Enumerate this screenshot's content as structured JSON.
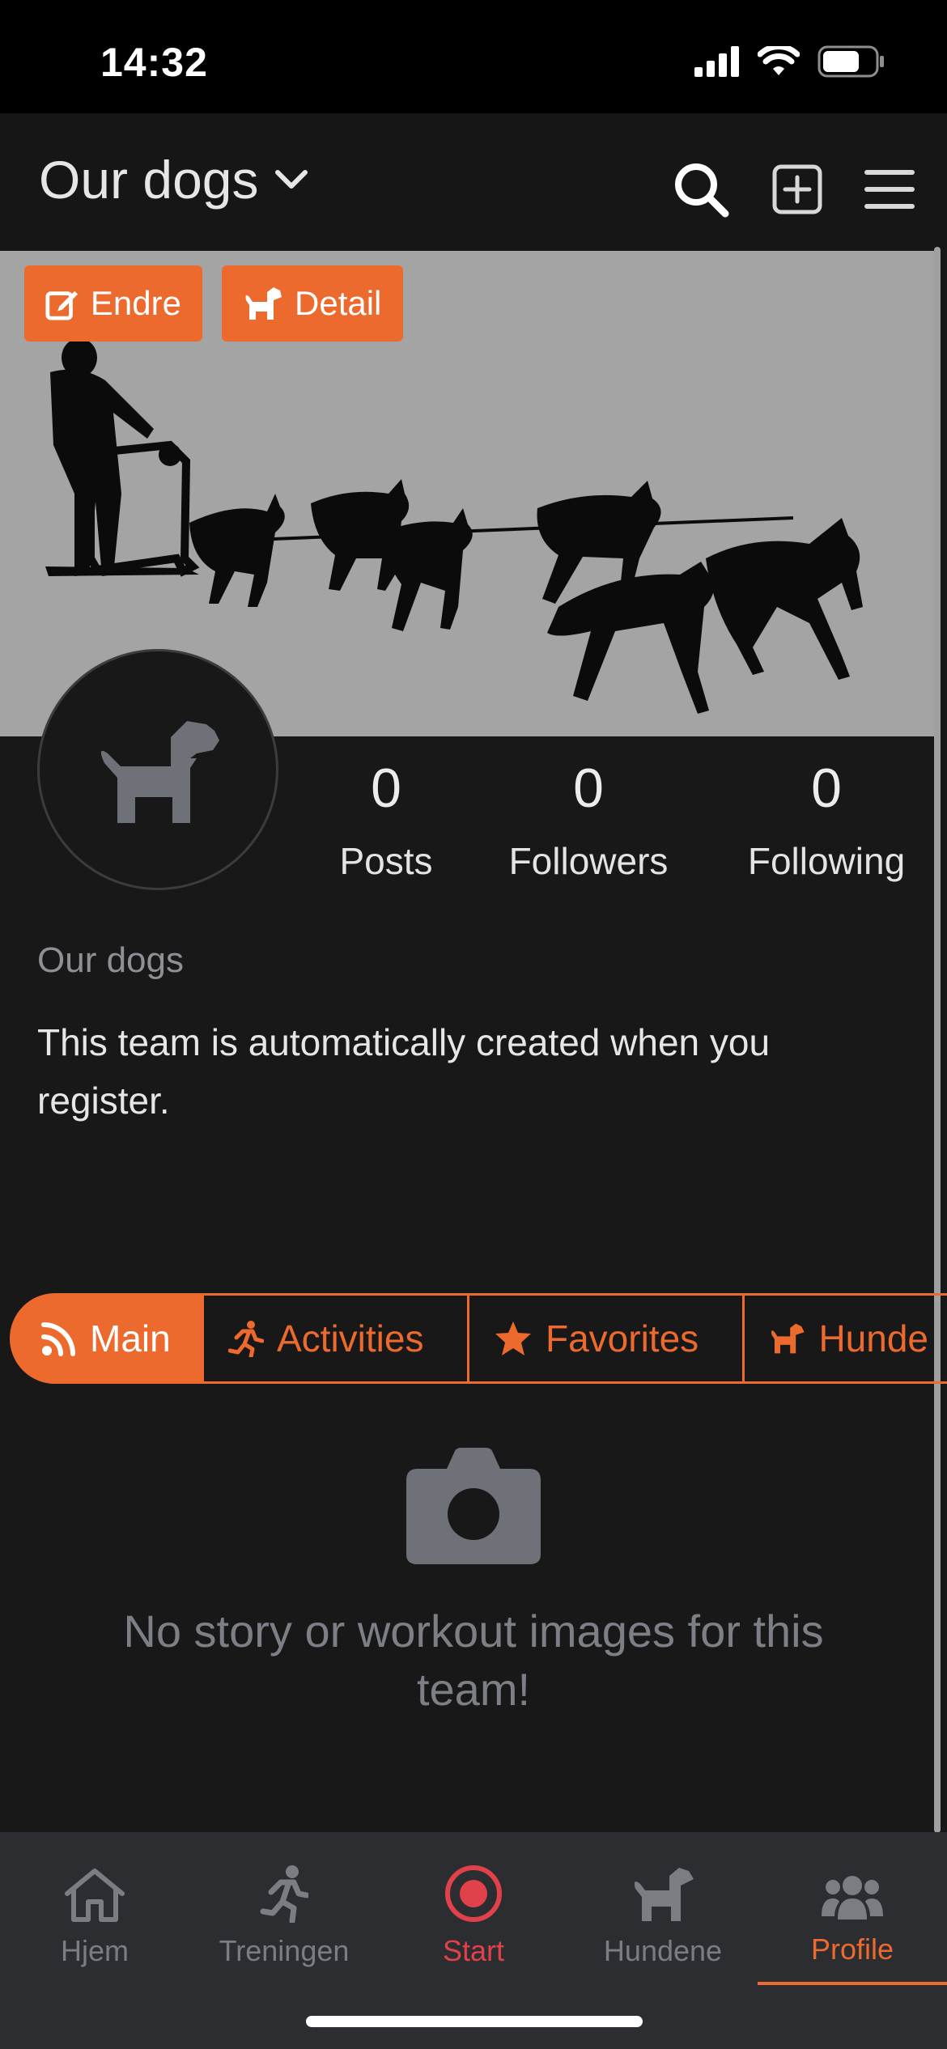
{
  "status_bar": {
    "time": "14:32"
  },
  "header": {
    "title": "Our dogs"
  },
  "cover": {
    "edit_label": "Endre",
    "detail_label": "Detail"
  },
  "stats": [
    {
      "value": "0",
      "label": "Posts"
    },
    {
      "value": "0",
      "label": "Followers"
    },
    {
      "value": "0",
      "label": "Following"
    }
  ],
  "profile": {
    "name": "Our dogs",
    "description": "This team is automatically created when you register."
  },
  "tabs": [
    {
      "label": "Main",
      "icon": "rss-icon",
      "active": true
    },
    {
      "label": "Activities",
      "icon": "running-icon"
    },
    {
      "label": "Favorites",
      "icon": "star-icon"
    },
    {
      "label": "Hunde",
      "icon": "dog-icon"
    }
  ],
  "empty_state": {
    "text": "No story or workout images for this team!"
  },
  "bottom_nav": [
    {
      "label": "Hjem",
      "icon": "home-icon"
    },
    {
      "label": "Treningen",
      "icon": "running-icon"
    },
    {
      "label": "Start",
      "icon": "record-icon"
    },
    {
      "label": "Hundene",
      "icon": "dog-icon"
    },
    {
      "label": "Profile",
      "icon": "people-icon",
      "active": true
    }
  ],
  "colors": {
    "accent": "#ec6a2e",
    "start": "#e0414a",
    "background": "#181819"
  }
}
